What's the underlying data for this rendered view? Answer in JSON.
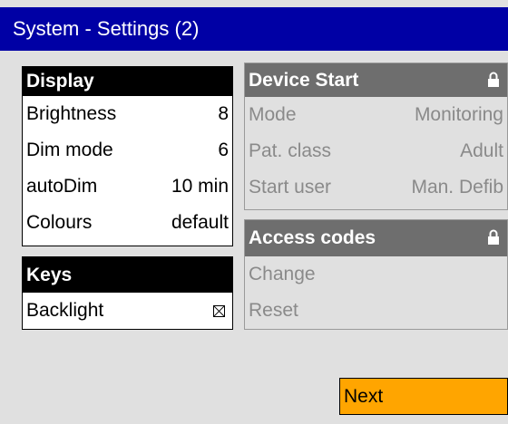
{
  "window": {
    "title": "System - Settings (2)"
  },
  "display": {
    "title": "Display",
    "rows": [
      {
        "label": "Brightness",
        "value": "8"
      },
      {
        "label": "Dim mode",
        "value": "6"
      },
      {
        "label": "autoDim",
        "value": "10 min"
      },
      {
        "label": "Colours",
        "value": "default"
      }
    ]
  },
  "keys": {
    "title": "Keys",
    "rows": [
      {
        "label": "Backlight",
        "checked": true
      }
    ]
  },
  "device_start": {
    "title": "Device Start",
    "locked": true,
    "rows": [
      {
        "label": "Mode",
        "value": "Monitoring"
      },
      {
        "label": "Pat. class",
        "value": "Adult"
      },
      {
        "label": "Start user",
        "value": "Man. Defib"
      }
    ]
  },
  "access_codes": {
    "title": "Access codes",
    "locked": true,
    "rows": [
      {
        "label": "Change"
      },
      {
        "label": "Reset"
      }
    ]
  },
  "footer": {
    "next_label": "Next"
  },
  "colors": {
    "titlebar": "#0000a5",
    "background": "#e0e0e0",
    "disabled_header": "#6e6e6e",
    "next_button": "#ffa500"
  }
}
